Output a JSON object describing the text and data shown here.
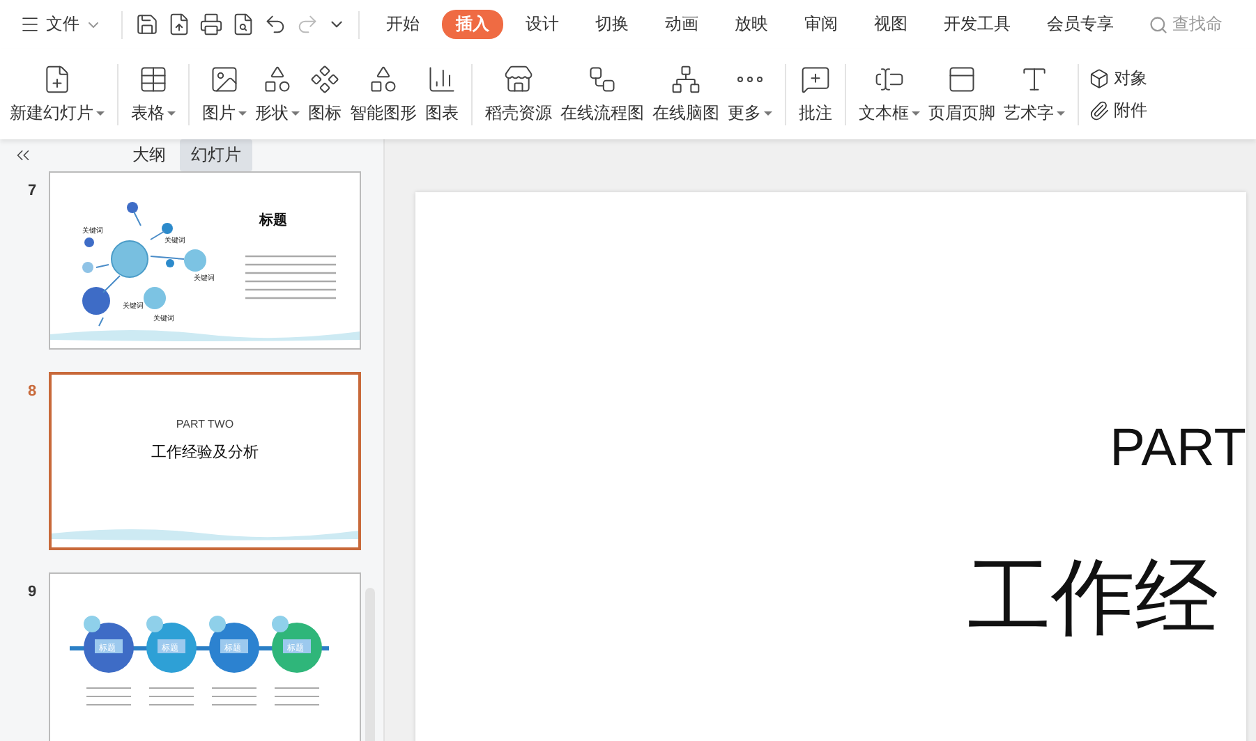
{
  "titlebar": {
    "file_menu": "文件",
    "tabs": [
      {
        "label": "开始",
        "selected": false
      },
      {
        "label": "插入",
        "selected": true
      },
      {
        "label": "设计",
        "selected": false
      },
      {
        "label": "切换",
        "selected": false
      },
      {
        "label": "动画",
        "selected": false
      },
      {
        "label": "放映",
        "selected": false
      },
      {
        "label": "审阅",
        "selected": false
      },
      {
        "label": "视图",
        "selected": false
      },
      {
        "label": "开发工具",
        "selected": false
      },
      {
        "label": "会员专享",
        "selected": false
      }
    ],
    "search": {
      "placeholder": "查找命"
    }
  },
  "ribbon": {
    "groups": [
      {
        "kind": "large",
        "items": [
          {
            "label": "新建幻灯片",
            "dropdown": true
          }
        ]
      },
      {
        "kind": "large",
        "items": [
          {
            "label": "表格",
            "dropdown": true
          }
        ]
      },
      {
        "kind": "large",
        "items": [
          {
            "label": "图片",
            "dropdown": true
          },
          {
            "label": "形状",
            "dropdown": true
          },
          {
            "label": "图标",
            "dropdown": false
          },
          {
            "label": "智能图形",
            "dropdown": false
          },
          {
            "label": "图表",
            "dropdown": false
          }
        ]
      },
      {
        "kind": "large",
        "items": [
          {
            "label": "稻壳资源",
            "dropdown": false
          },
          {
            "label": "在线流程图",
            "dropdown": false
          },
          {
            "label": "在线脑图",
            "dropdown": false
          },
          {
            "label": "更多",
            "dropdown": true
          }
        ]
      },
      {
        "kind": "large",
        "items": [
          {
            "label": "批注",
            "dropdown": false
          }
        ]
      },
      {
        "kind": "large",
        "items": [
          {
            "label": "文本框",
            "dropdown": true
          },
          {
            "label": "页眉页脚",
            "dropdown": false
          },
          {
            "label": "艺术字",
            "dropdown": true
          }
        ]
      },
      {
        "kind": "small",
        "items": [
          {
            "label": "对象",
            "dropdown": false
          },
          {
            "label": "附件",
            "dropdown": false
          }
        ]
      }
    ]
  },
  "panel": {
    "view_tabs": [
      {
        "label": "大纲",
        "selected": false
      },
      {
        "label": "幻灯片",
        "selected": true
      }
    ],
    "slides": [
      {
        "number": "7",
        "selected": false,
        "kind": "bubbles",
        "title": "标题",
        "keywords": [
          "关键词",
          "关键词",
          "关键词",
          "关键词",
          "关键词"
        ]
      },
      {
        "number": "8",
        "selected": true,
        "kind": "section",
        "subtitle": "PART TWO",
        "title": "工作经验及分析"
      },
      {
        "number": "9",
        "selected": false,
        "kind": "timeline",
        "labels": [
          "标题",
          "标题",
          "标题",
          "标题"
        ]
      }
    ]
  },
  "slide": {
    "subtitle": "PART",
    "title": "工作经"
  }
}
